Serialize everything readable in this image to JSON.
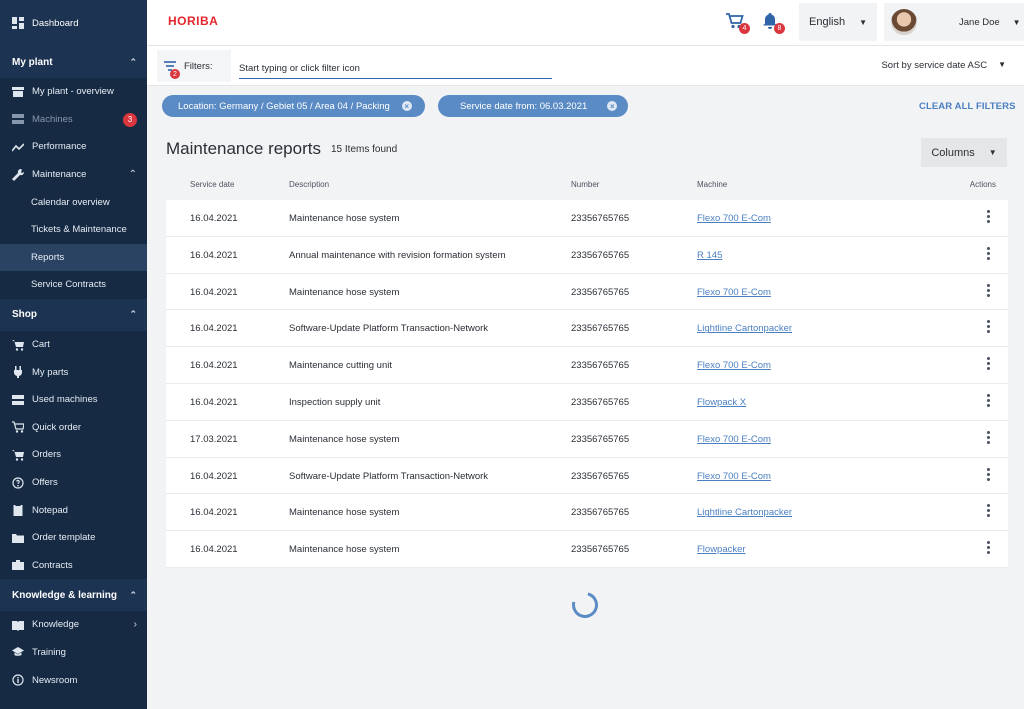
{
  "sidebar": {
    "dashboard": "Dashboard",
    "sections": {
      "my_plant": "My plant",
      "shop": "Shop",
      "knowledge": "Knowledge & learning"
    },
    "my_plant_items": {
      "overview": "My plant - overview",
      "machines": "Machines",
      "machines_badge": "3",
      "performance": "Performance",
      "maintenance": "Maintenance"
    },
    "maintenance_sub": {
      "calendar": "Calendar overview",
      "tickets": "Tickets & Maintenance",
      "reports": "Reports",
      "contracts": "Service Contracts"
    },
    "shop_items": {
      "cart": "Cart",
      "parts": "My parts",
      "used": "Used machines",
      "quick": "Quick order",
      "orders": "Orders",
      "offers": "Offers",
      "notepad": "Notepad",
      "template": "Order template",
      "contracts": "Contracts"
    },
    "knowledge_items": {
      "knowledge": "Knowledge",
      "training": "Training",
      "newsroom": "Newsroom"
    }
  },
  "header": {
    "logo": "HORIBA",
    "cart_badge": "4",
    "bell_badge": "8",
    "language": "English",
    "username": "Jane Doe"
  },
  "filters": {
    "label": "Filters:",
    "badge": "2",
    "placeholder": "Start typing or click filter icon",
    "sort": "Sort by service date ASC",
    "chips": {
      "location": "Location: Germany / Gebiet 05 / Area 04 / Packing",
      "date": "Service date from: 06.03.2021"
    },
    "clear_all": "CLEAR ALL FILTERS"
  },
  "main": {
    "title": "Maintenance reports",
    "count": "15 Items found",
    "columns_btn": "Columns"
  },
  "table": {
    "headers": {
      "date": "Service date",
      "description": "Description",
      "number": "Number",
      "machine": "Machine",
      "actions": "Actions"
    },
    "rows": [
      {
        "date": "16.04.2021",
        "description": "Maintenance hose system",
        "number": "23356765765",
        "machine": "Flexo 700 E-Com"
      },
      {
        "date": "16.04.2021",
        "description": "Annual maintenance with revision formation system",
        "number": "23356765765",
        "machine": "R 145"
      },
      {
        "date": "16.04.2021",
        "description": "Maintenance hose system",
        "number": "23356765765",
        "machine": "Flexo 700 E-Com"
      },
      {
        "date": "16.04.2021",
        "description": "Software-Update Platform Transaction-Network",
        "number": "23356765765",
        "machine": "Lightline Cartonpacker"
      },
      {
        "date": "16.04.2021",
        "description": "Maintenance cutting unit",
        "number": "23356765765",
        "machine": "Flexo 700 E-Com"
      },
      {
        "date": "16.04.2021",
        "description": "Inspection supply unit",
        "number": "23356765765",
        "machine": "Flowpack X"
      },
      {
        "date": "17.03.2021",
        "description": "Maintenance hose system",
        "number": "23356765765",
        "machine": "Flexo 700 E-Com"
      },
      {
        "date": "16.04.2021",
        "description": "Software-Update Platform Transaction-Network",
        "number": "23356765765",
        "machine": "Flexo 700 E-Com"
      },
      {
        "date": "16.04.2021",
        "description": "Maintenance hose system",
        "number": "23356765765",
        "machine": "Lightline Cartonpacker"
      },
      {
        "date": "16.04.2021",
        "description": "Maintenance hose system",
        "number": "23356765765",
        "machine": "Flowpacker"
      }
    ]
  }
}
